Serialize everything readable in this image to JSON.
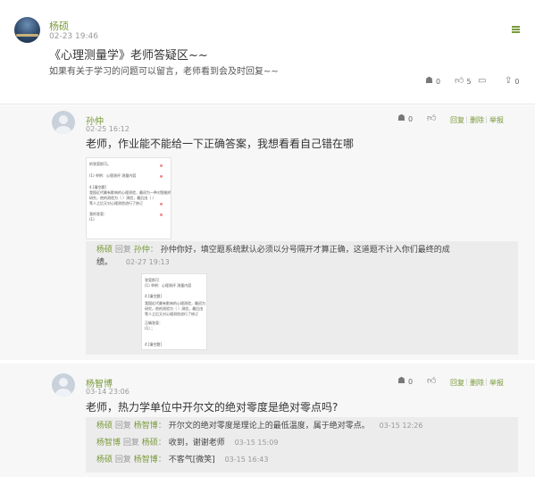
{
  "post": {
    "author": "杨硕",
    "time": "02-23 19:46",
    "title": "《心理测量学》老师答疑区~~",
    "body": "如果有关于学习的问题可以留言，老师看到会及时回复~~",
    "stats": {
      "views_count": "0",
      "likes_count": "5",
      "comments_count": "0"
    }
  },
  "comments": [
    {
      "author": "孙仲",
      "time": "02-25 16:12",
      "text": "老师，作业能不能给一下正确答案，我想看看自己错在哪",
      "likes_count": "0",
      "actions": {
        "reply": "回复",
        "delete": "删除",
        "report": "举报"
      },
      "attachment": {
        "lines": [
          "的答案即可。",
          "(1) 举例：心理测评 测量内容",
          "4.[填空题]",
          "我国近代最有影响的心理测验，最初为一种对智能的",
          "研究，他的测验为（   ）测验，最后由（   ）",
          "等人之后又对心理测验进行了修订",
          "我的答案：",
          "(1)"
        ]
      },
      "replies": [
        {
          "author": "杨硕",
          "verb": "回复",
          "target": "孙仲",
          "text": "孙仲你好，填空题系统默认必须以分号隔开才算正确，这道题不计入你们最终的成绩。",
          "line1": "孙仲你好，填空题系统默认必须以分号隔开才算正确，这道题不计入你们最终的成",
          "line2": "绩。",
          "time": "02-27 19:13",
          "attachment": {
            "lines": [
              "答案即可",
              "(1) 举例：心理测评 测量内容",
              "4.[填空题]",
              "我国近代最有影响的心理测验，最初为",
              "研究，他的测验为（ ）测验，最后由",
              "等人之后又对心理测验进行了修订",
              "正确答案：",
              "(1) ；",
              "4.[填空题]"
            ]
          }
        }
      ]
    },
    {
      "author": "杨智博",
      "time": "03-14 23:06",
      "text": "老师，热力学单位中开尔文的绝对零度是绝对零点吗?",
      "likes_count": "0",
      "actions": {
        "reply": "回复",
        "delete": "删除",
        "report": "举报"
      },
      "replies": [
        {
          "author": "杨硕",
          "verb": "回复",
          "target": "杨智博",
          "text": "开尔文的绝对零度是理论上的最低温度，属于绝对零点。",
          "time": "03-15 12:26"
        },
        {
          "author": "杨智博",
          "verb": "回复",
          "target": "杨硕",
          "text": "收到，谢谢老师",
          "time": "03-15 15:09"
        },
        {
          "author": "杨硕",
          "verb": "回复",
          "target": "杨智博",
          "text": "不客气[微笑]",
          "time": "03-15 16:43"
        }
      ]
    }
  ],
  "colors": {
    "accent": "#7a9a3a",
    "comment_bg": "#f7f7f7",
    "reply_bg": "#ececec"
  }
}
